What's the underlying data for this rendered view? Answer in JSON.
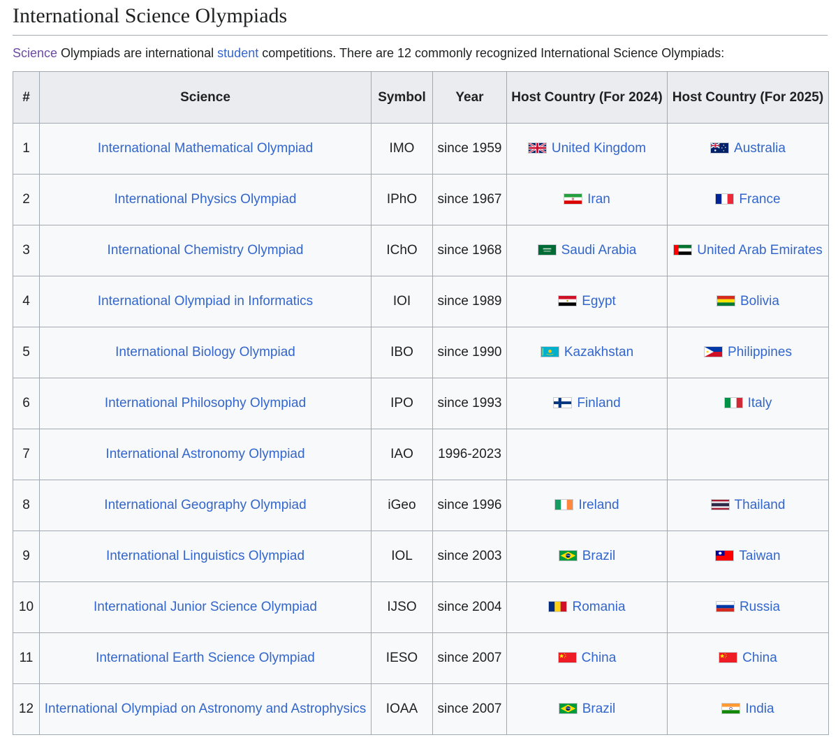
{
  "title": "International Science Olympiads",
  "intro": {
    "link1": "Science",
    "text1": " Olympiads are international ",
    "link2": "student",
    "text2": " competitions. There are 12 commonly recognized International Science Olympiads:"
  },
  "table": {
    "headers": [
      "#",
      "Science",
      "Symbol",
      "Year",
      "Host Country (For 2024)",
      "Host Country (For 2025)"
    ],
    "rows": [
      {
        "num": "1",
        "science": "International Mathematical Olympiad",
        "symbol": "IMO",
        "year": "since 1959",
        "host2024": "United Kingdom",
        "flag2024": "gb",
        "host2025": "Australia",
        "flag2025": "au"
      },
      {
        "num": "2",
        "science": "International Physics Olympiad",
        "symbol": "IPhO",
        "year": "since 1967",
        "host2024": "Iran",
        "flag2024": "ir",
        "host2025": "France",
        "flag2025": "fr"
      },
      {
        "num": "3",
        "science": "International Chemistry Olympiad",
        "symbol": "IChO",
        "year": "since 1968",
        "host2024": "Saudi Arabia",
        "flag2024": "sa",
        "host2025": "United Arab Emirates",
        "flag2025": "ae"
      },
      {
        "num": "4",
        "science": "International Olympiad in Informatics",
        "symbol": "IOI",
        "year": "since 1989",
        "host2024": "Egypt",
        "flag2024": "eg",
        "host2025": "Bolivia",
        "flag2025": "bo"
      },
      {
        "num": "5",
        "science": "International Biology Olympiad",
        "symbol": "IBO",
        "year": "since 1990",
        "host2024": "Kazakhstan",
        "flag2024": "kz",
        "host2025": "Philippines",
        "flag2025": "ph"
      },
      {
        "num": "6",
        "science": "International Philosophy Olympiad",
        "symbol": "IPO",
        "year": "since 1993",
        "host2024": "Finland",
        "flag2024": "fi",
        "host2025": "Italy",
        "flag2025": "it"
      },
      {
        "num": "7",
        "science": "International Astronomy Olympiad",
        "symbol": "IAO",
        "year": "1996-2023",
        "host2024": "",
        "flag2024": "",
        "host2025": "",
        "flag2025": ""
      },
      {
        "num": "8",
        "science": "International Geography Olympiad",
        "symbol": "iGeo",
        "year": "since 1996",
        "host2024": "Ireland",
        "flag2024": "ie",
        "host2025": "Thailand",
        "flag2025": "th"
      },
      {
        "num": "9",
        "science": "International Linguistics Olympiad",
        "symbol": "IOL",
        "year": "since 2003",
        "host2024": "Brazil",
        "flag2024": "br",
        "host2025": "Taiwan",
        "flag2025": "tw"
      },
      {
        "num": "10",
        "science": "International Junior Science Olympiad",
        "symbol": "IJSO",
        "year": "since 2004",
        "host2024": "Romania",
        "flag2024": "ro",
        "host2025": "Russia",
        "flag2025": "ru"
      },
      {
        "num": "11",
        "science": "International Earth Science Olympiad",
        "symbol": "IESO",
        "year": "since 2007",
        "host2024": "China",
        "flag2024": "cn",
        "host2025": "China",
        "flag2025": "cn"
      },
      {
        "num": "12",
        "science": "International Olympiad on Astronomy and Astrophysics",
        "symbol": "IOAA",
        "year": "since 2007",
        "host2024": "Brazil",
        "flag2024": "br",
        "host2025": "India",
        "flag2025": "in"
      }
    ]
  },
  "colors": {
    "link": "#3366cc",
    "visited_link": "#6b4ba1",
    "header_bg": "#eaecf0",
    "cell_bg": "#f8f9fa",
    "border": "#a2a9b1"
  }
}
